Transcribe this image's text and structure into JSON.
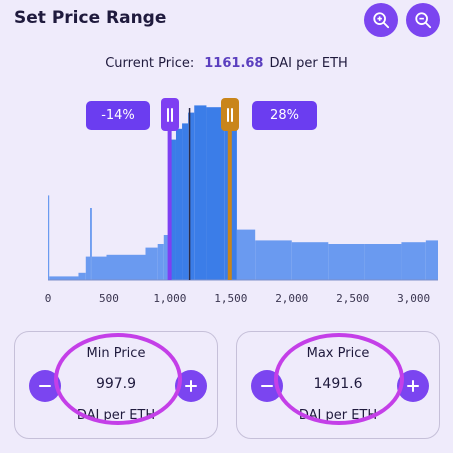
{
  "header": {
    "title": "Set Price Range"
  },
  "current_price": {
    "label": "Current Price:",
    "value": "1161.68",
    "unit": "DAI per ETH"
  },
  "range": {
    "min_change": "-14%",
    "max_change": "28%"
  },
  "min_card": {
    "label": "Min Price",
    "value": "997.9",
    "unit": "DAI per ETH"
  },
  "max_card": {
    "label": "Max Price",
    "value": "1491.6",
    "unit": "DAI per ETH"
  },
  "colors": {
    "accent": "#7b45f0",
    "bars": "#6a9af0",
    "bars_in_range": "#3b7de8",
    "min_handle": "#7e3ff2",
    "max_handle": "#c9851a",
    "annotation": "#c43fe8"
  },
  "icons": {
    "zoom_in": "zoom-in-icon",
    "zoom_out": "zoom-out-icon",
    "minus": "minus-icon",
    "plus": "plus-icon"
  },
  "chart_data": {
    "type": "bar",
    "xlabel": "",
    "ylabel": "",
    "x_ticks": [
      0,
      500,
      1000,
      1500,
      2000,
      2500,
      3000
    ],
    "x_tick_labels": [
      "0",
      "500",
      "1,000",
      "1,500",
      "2,000",
      "2,500",
      "3,000"
    ],
    "xlim": [
      0,
      3200
    ],
    "ylim": [
      0,
      100
    ],
    "grid": false,
    "current_price": 1161.68,
    "min_price": 997.9,
    "max_price": 1491.6,
    "bins": [
      {
        "x0": 0,
        "x1": 10,
        "value": 47
      },
      {
        "x0": 10,
        "x1": 250,
        "value": 2
      },
      {
        "x0": 250,
        "x1": 310,
        "value": 4
      },
      {
        "x0": 310,
        "x1": 345,
        "value": 13
      },
      {
        "x0": 345,
        "x1": 360,
        "value": 40
      },
      {
        "x0": 360,
        "x1": 480,
        "value": 13
      },
      {
        "x0": 480,
        "x1": 800,
        "value": 14
      },
      {
        "x0": 800,
        "x1": 900,
        "value": 18
      },
      {
        "x0": 900,
        "x1": 950,
        "value": 20
      },
      {
        "x0": 950,
        "x1": 1000,
        "value": 25
      },
      {
        "x0": 1000,
        "x1": 1050,
        "value": 78
      },
      {
        "x0": 1050,
        "x1": 1100,
        "value": 84
      },
      {
        "x0": 1100,
        "x1": 1150,
        "value": 87
      },
      {
        "x0": 1150,
        "x1": 1200,
        "value": 93
      },
      {
        "x0": 1200,
        "x1": 1300,
        "value": 97
      },
      {
        "x0": 1300,
        "x1": 1450,
        "value": 96
      },
      {
        "x0": 1450,
        "x1": 1550,
        "value": 95
      },
      {
        "x0": 1550,
        "x1": 1700,
        "value": 28
      },
      {
        "x0": 1700,
        "x1": 2000,
        "value": 22
      },
      {
        "x0": 2000,
        "x1": 2300,
        "value": 21
      },
      {
        "x0": 2300,
        "x1": 2600,
        "value": 20
      },
      {
        "x0": 2600,
        "x1": 2900,
        "value": 20
      },
      {
        "x0": 2900,
        "x1": 3100,
        "value": 21
      },
      {
        "x0": 3100,
        "x1": 3200,
        "value": 22
      }
    ]
  }
}
